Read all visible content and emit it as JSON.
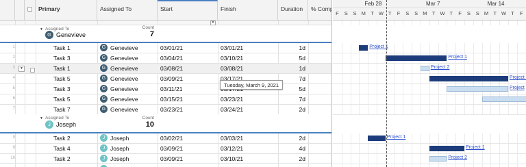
{
  "columns": {
    "primary": "Primary",
    "assigned": "Assigned To",
    "start": "Start",
    "finish": "Finish",
    "duration": "Duration",
    "complete": "% Compl"
  },
  "groups": [
    {
      "label": "Assigned To",
      "name": "Genevieve",
      "initial": "G",
      "count_label": "Count",
      "count": "7",
      "rows": [
        {
          "num": "1",
          "task": "Task 1",
          "assignee": "Genevieve",
          "initial": "G",
          "start": "03/01/21",
          "finish": "03/01/21",
          "duration": "1d"
        },
        {
          "num": "2",
          "task": "Task 3",
          "assignee": "Genevieve",
          "initial": "G",
          "start": "03/04/21",
          "finish": "03/10/21",
          "duration": "5d"
        },
        {
          "num": "3",
          "task": "Task 1",
          "assignee": "Genevieve",
          "initial": "G",
          "start": "03/08/21",
          "finish": "03/08/21",
          "duration": "1d"
        },
        {
          "num": "4",
          "task": "Task 5",
          "assignee": "Genevieve",
          "initial": "G",
          "start": "03/09/21",
          "finish": "03/17/21",
          "duration": "7d"
        },
        {
          "num": "5",
          "task": "Task 3",
          "assignee": "Genevieve",
          "initial": "G",
          "start": "03/11/21",
          "finish": "03/17/21",
          "duration": "5d"
        },
        {
          "num": "6",
          "task": "Task 5",
          "assignee": "Genevieve",
          "initial": "G",
          "start": "03/15/21",
          "finish": "03/23/21",
          "duration": "7d"
        },
        {
          "num": "7",
          "task": "Task 7",
          "assignee": "Genevieve",
          "initial": "G",
          "start": "03/23/21",
          "finish": "03/24/21",
          "duration": "2d"
        }
      ]
    },
    {
      "label": "Assigned To",
      "name": "Joseph",
      "initial": "J",
      "count_label": "Count",
      "count": "10",
      "rows": [
        {
          "num": "9",
          "task": "Task 2",
          "assignee": "Joseph",
          "initial": "J",
          "start": "03/02/21",
          "finish": "03/03/21",
          "duration": "2d"
        },
        {
          "num": "9",
          "task": "Task 4",
          "assignee": "Joseph",
          "initial": "J",
          "start": "03/09/21",
          "finish": "03/12/21",
          "duration": "4d"
        },
        {
          "num": "10",
          "task": "Task 2",
          "assignee": "Joseph",
          "initial": "J",
          "start": "03/09/21",
          "finish": "03/10/21",
          "duration": "2d"
        }
      ]
    }
  ],
  "tooltip": "Tuesday, March 9, 2021",
  "timeline": {
    "weeks": [
      "Feb 28",
      "Mar 7",
      "Mar 14"
    ],
    "days": [
      "F",
      "S",
      "S",
      "M",
      "T",
      "W",
      "T",
      "F",
      "S",
      "S",
      "M",
      "T",
      "W",
      "T",
      "F",
      "S",
      "S",
      "M",
      "T",
      "W",
      "T",
      "F"
    ]
  },
  "bars": [
    {
      "label": "Project 1",
      "style": "dark"
    },
    {
      "label": "Project 1",
      "style": "dark"
    },
    {
      "label": "Project 2",
      "style": "light"
    },
    {
      "label": "Project 1",
      "style": "dark"
    },
    {
      "label": "Project",
      "style": "light"
    },
    {
      "label": "",
      "style": "light"
    },
    {
      "label": "Project 1",
      "style": "dark"
    },
    {
      "label": "Project 1",
      "style": "dark"
    },
    {
      "label": "Project 2",
      "style": "light"
    }
  ],
  "colors": {
    "accent": "#4a7fc1",
    "bar_dark": "#1c3c7c",
    "bar_light": "#c9def0",
    "link": "#2a4fd0"
  }
}
